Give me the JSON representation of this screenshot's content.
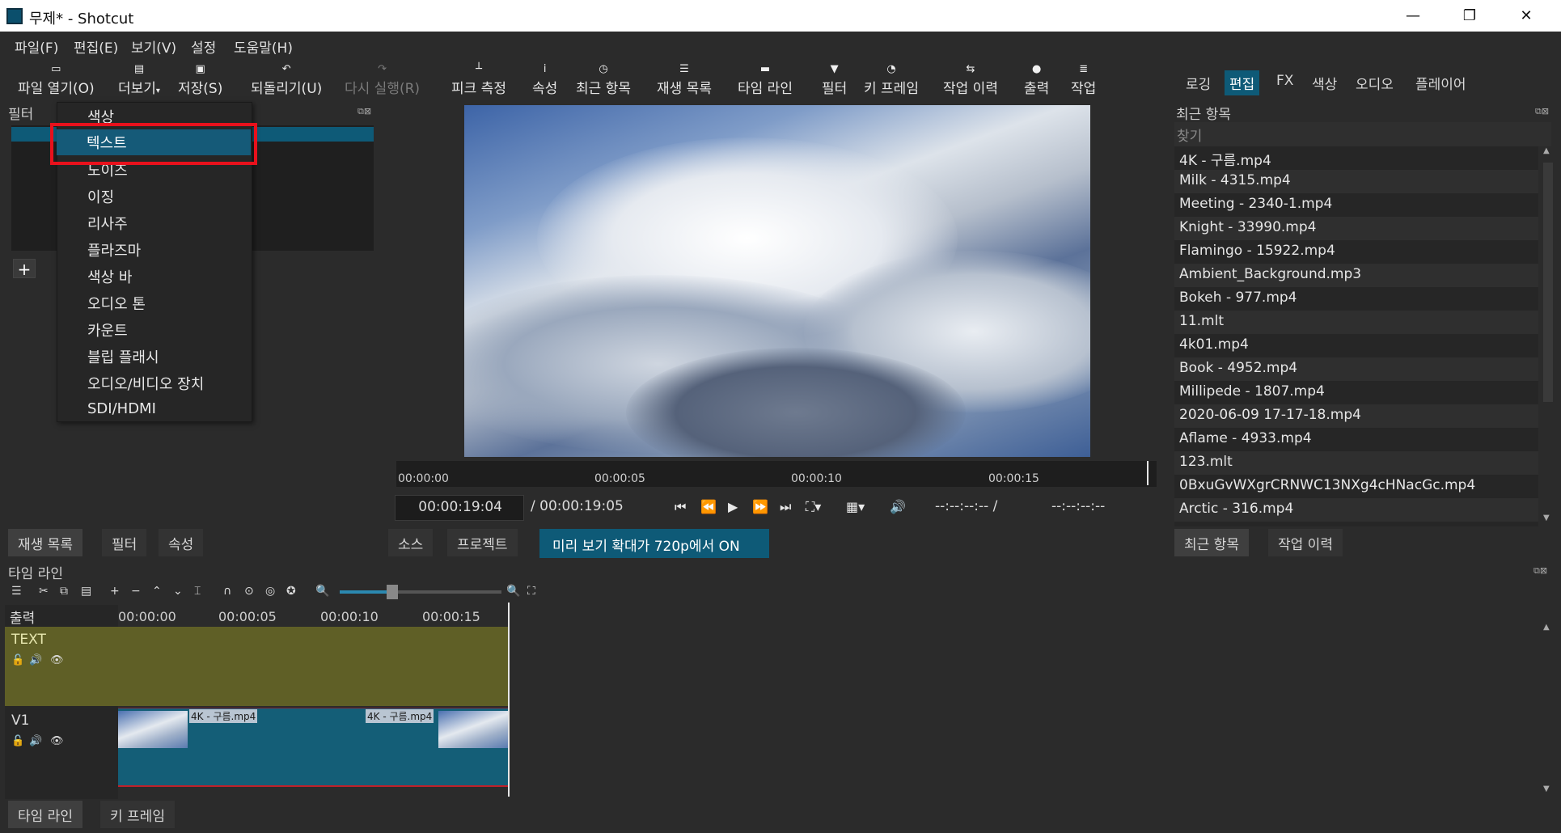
{
  "window": {
    "title": "무제* - Shotcut",
    "minimize": "—",
    "restore": "❐",
    "close": "✕"
  },
  "menu": [
    "파일(F)",
    "편집(E)",
    "보기(V)",
    "설정",
    "도움말(H)"
  ],
  "toolbar": {
    "open": "파일 열기(O)",
    "more": "더보기",
    "save": "저장(S)",
    "undo": "되돌리기(U)",
    "redo": "다시 실행(R)",
    "peak": "피크 측정",
    "properties": "속성",
    "recent": "최근 항목",
    "playlist": "재생 목록",
    "timeline": "타임 라인",
    "filters": "필터",
    "keyframes": "키 프레임",
    "history": "작업 이력",
    "export": "출력",
    "jobs": "작업"
  },
  "layouts": [
    "로깅",
    "편집",
    "FX",
    "색상",
    "오디오",
    "플레이어"
  ],
  "filter_panel": {
    "title": "필터"
  },
  "dropdown": {
    "items": [
      "색상",
      "텍스트",
      "노이즈",
      "이징",
      "리사주",
      "플라즈마",
      "색상 바",
      "오디오 톤",
      "카운트",
      "블립 플래시",
      "오디오/비디오 장치",
      "SDI/HDMI"
    ],
    "highlighted": "텍스트"
  },
  "preview": {
    "ruler": [
      "00:00:00",
      "00:00:05",
      "00:00:10",
      "00:00:15"
    ],
    "current_time": "00:00:19:04",
    "duration": "/ 00:00:19:05",
    "in_out": "--:--:--:-- /",
    "out": "--:--:--:--",
    "tabs": [
      "소스",
      "프로젝트"
    ],
    "scale_notice": "미리 보기 확대가 720p에서 ON"
  },
  "left_tabs": [
    "재생 목록",
    "필터",
    "속성"
  ],
  "recent_panel": {
    "title": "최근 항목",
    "search_placeholder": "찾기",
    "items": [
      "4K - 구름.mp4",
      "Milk - 4315.mp4",
      "Meeting - 2340-1.mp4",
      "Knight - 33990.mp4",
      "Flamingo - 15922.mp4",
      "Ambient_Background.mp3",
      "Bokeh - 977.mp4",
      "11.mlt",
      "4k01.mp4",
      "Book - 4952.mp4",
      "Millipede - 1807.mp4",
      "2020-06-09 17-17-18.mp4",
      "Aflame - 4933.mp4",
      "123.mlt",
      "0BxuGvWXgrCRNWC13NXg4cHNacGc.mp4",
      "Arctic - 316.mp4"
    ],
    "tabs": [
      "최근 항목",
      "작업 이력"
    ]
  },
  "timeline": {
    "title": "타임 라인",
    "output_label": "출력",
    "ruler": [
      "00:00:00",
      "00:00:05",
      "00:00:10",
      "00:00:15"
    ],
    "tracks": [
      {
        "name": "TEXT"
      },
      {
        "name": "V1"
      }
    ],
    "clip_label": "4K - 구름.mp4"
  },
  "bottom_tabs": [
    "타임 라인",
    "키 프레임"
  ],
  "colors": {
    "accent": "#0e5a77",
    "highlight": "#155a78",
    "redbox": "#e8111c",
    "text_track": "#5f5f26"
  }
}
